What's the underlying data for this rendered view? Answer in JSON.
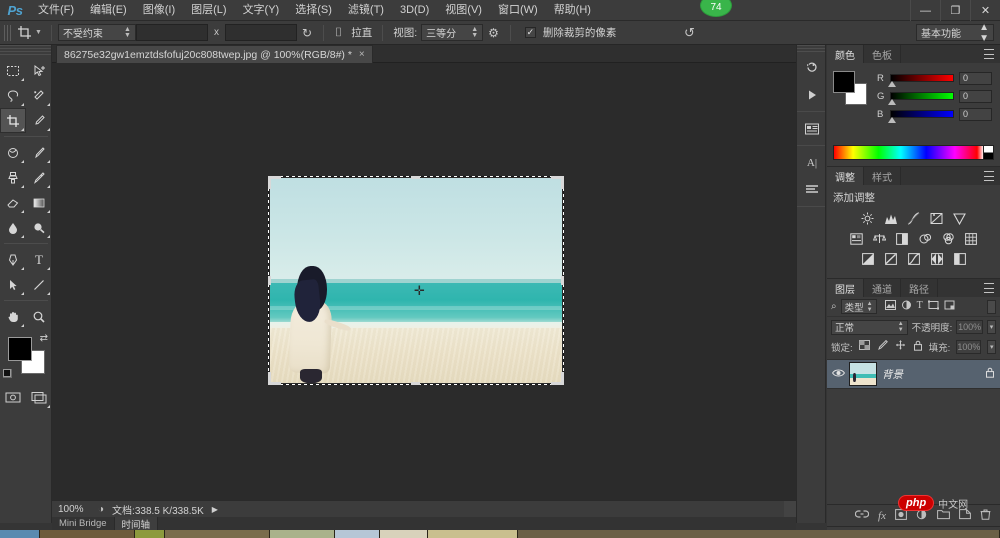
{
  "app": {
    "logo": "Ps",
    "badge_count": "74",
    "badge_color": "#39b54a"
  },
  "menubar": {
    "items": [
      {
        "label": "文件(F)",
        "name": "menu-file"
      },
      {
        "label": "编辑(E)",
        "name": "menu-edit"
      },
      {
        "label": "图像(I)",
        "name": "menu-image"
      },
      {
        "label": "图层(L)",
        "name": "menu-layer"
      },
      {
        "label": "文字(Y)",
        "name": "menu-type"
      },
      {
        "label": "选择(S)",
        "name": "menu-select"
      },
      {
        "label": "滤镜(T)",
        "name": "menu-filter"
      },
      {
        "label": "3D(D)",
        "name": "menu-3d"
      },
      {
        "label": "视图(V)",
        "name": "menu-view"
      },
      {
        "label": "窗口(W)",
        "name": "menu-window"
      },
      {
        "label": "帮助(H)",
        "name": "menu-help"
      }
    ],
    "window_controls": {
      "minimize": "—",
      "restore": "❐",
      "close": "✕"
    }
  },
  "options_bar": {
    "tool_icon": "crop-icon",
    "ratio_select": "不受约束",
    "width_value": "",
    "height_value": "",
    "separator_x": "x",
    "swap_icon": "↻",
    "clear_icon": "⌷",
    "straighten_label": "拉直",
    "view_label": "视图:",
    "view_select": "三等分",
    "settings_icon": "gear-icon",
    "delete_cropped_label": "删除裁剪的像素",
    "delete_cropped_checked": "✓",
    "reset_icon": "↺",
    "workspace_select": "基本功能"
  },
  "document": {
    "tab_title": "86275e32gw1emztdsfofuj20c808twep.jpg @ 100%(RGB/8#) *",
    "close_icon": "×"
  },
  "toolbar": {
    "tools": [
      {
        "name": "marquee-tool",
        "glyph": "▢",
        "active": false
      },
      {
        "name": "move-tool",
        "glyph": "⊹",
        "active": false
      },
      {
        "name": "lasso-tool",
        "glyph": "◌",
        "active": false
      },
      {
        "name": "quick-selection-tool",
        "glyph": "✦",
        "active": false
      },
      {
        "name": "crop-tool",
        "glyph": "⌗",
        "active": true
      },
      {
        "name": "eyedropper-tool",
        "glyph": "✎",
        "active": false
      },
      {
        "name": "spot-healing-tool",
        "glyph": "◉",
        "active": false
      },
      {
        "name": "brush-tool",
        "glyph": "✏",
        "active": false
      },
      {
        "name": "clone-stamp-tool",
        "glyph": "⌷",
        "active": false
      },
      {
        "name": "history-brush-tool",
        "glyph": "✒",
        "active": false
      },
      {
        "name": "eraser-tool",
        "glyph": "◐",
        "active": false
      },
      {
        "name": "gradient-tool",
        "glyph": "▤",
        "active": false
      },
      {
        "name": "blur-tool",
        "glyph": "💧",
        "active": false
      },
      {
        "name": "dodge-tool",
        "glyph": "⚲",
        "active": false
      },
      {
        "name": "pen-tool",
        "glyph": "✐",
        "active": false
      },
      {
        "name": "type-tool",
        "glyph": "T",
        "active": false
      },
      {
        "name": "path-selection-tool",
        "glyph": "➤",
        "active": false
      },
      {
        "name": "line-shape-tool",
        "glyph": "／",
        "active": false
      },
      {
        "name": "hand-tool",
        "glyph": "✋",
        "active": false
      },
      {
        "name": "zoom-tool",
        "glyph": "🔍",
        "active": false
      }
    ],
    "foreground_color": "#000000",
    "background_color": "#ffffff",
    "swap_icon": "⇄",
    "quickmask_icon": "◱",
    "screenmode_icon": "❐"
  },
  "canvas": {
    "background_color": "#2b2b2b",
    "cursor_glyph": "✛",
    "image_alt": "beach-photo"
  },
  "statusbar": {
    "zoom": "100%",
    "zoom_icon": "◑",
    "doc_info": "文档:338.5 K/338.5K",
    "expand_icon": "▶"
  },
  "bottom_tabs": [
    {
      "label": "Mini Bridge",
      "name": "tab-mini-bridge",
      "active": false
    },
    {
      "label": "时间轴",
      "name": "tab-timeline",
      "active": true
    }
  ],
  "minidock": {
    "buttons": [
      {
        "name": "history-panel-icon",
        "glyph": "↻"
      },
      {
        "name": "actions-panel-icon",
        "glyph": "▶"
      },
      {
        "name": "mini-bridge-icon",
        "glyph": "▣"
      },
      {
        "name": "character-panel-icon",
        "glyph": "A|"
      },
      {
        "name": "paragraph-panel-icon",
        "glyph": "◀"
      }
    ]
  },
  "color_panel": {
    "tabs": [
      {
        "label": "颜色",
        "name": "tab-color",
        "active": true
      },
      {
        "label": "色板",
        "name": "tab-swatches",
        "active": false
      }
    ],
    "channels": [
      {
        "label": "R",
        "value": "0"
      },
      {
        "label": "G",
        "value": "0"
      },
      {
        "label": "B",
        "value": "0"
      }
    ],
    "foreground_color": "#000000",
    "background_color": "#ffffff"
  },
  "adjustments_panel": {
    "tabs": [
      {
        "label": "调整",
        "name": "tab-adjustments",
        "active": true
      },
      {
        "label": "样式",
        "name": "tab-styles",
        "active": false
      }
    ],
    "title": "添加调整",
    "row1": [
      {
        "name": "brightness-contrast-icon",
        "glyph": "☀"
      },
      {
        "name": "levels-icon",
        "glyph": "▄"
      },
      {
        "name": "curves-icon",
        "glyph": "∿"
      },
      {
        "name": "exposure-icon",
        "glyph": "⊿"
      },
      {
        "name": "vibrance-icon",
        "glyph": "▽"
      }
    ],
    "row2": [
      {
        "name": "hue-saturation-icon",
        "glyph": "▩"
      },
      {
        "name": "color-balance-icon",
        "glyph": "⚖"
      },
      {
        "name": "black-white-icon",
        "glyph": "◨"
      },
      {
        "name": "photo-filter-icon",
        "glyph": "◍"
      },
      {
        "name": "channel-mixer-icon",
        "glyph": "❂"
      },
      {
        "name": "color-lookup-icon",
        "glyph": "▦"
      }
    ],
    "row3": [
      {
        "name": "invert-icon",
        "glyph": "◪"
      },
      {
        "name": "posterize-icon",
        "glyph": "◲"
      },
      {
        "name": "threshold-icon",
        "glyph": "◩"
      },
      {
        "name": "gradient-map-icon",
        "glyph": "◤"
      },
      {
        "name": "selective-color-icon",
        "glyph": "◧"
      }
    ]
  },
  "layers_panel": {
    "tabs": [
      {
        "label": "图层",
        "name": "tab-layers",
        "active": true
      },
      {
        "label": "通道",
        "name": "tab-channels",
        "active": false
      },
      {
        "label": "路径",
        "name": "tab-paths",
        "active": false
      }
    ],
    "filter": {
      "search_icon": "⌕",
      "kind_label": "类型",
      "icons": [
        {
          "name": "filter-pixel-icon",
          "glyph": "▣"
        },
        {
          "name": "filter-adjustment-icon",
          "glyph": "◑"
        },
        {
          "name": "filter-type-icon",
          "glyph": "T"
        },
        {
          "name": "filter-shape-icon",
          "glyph": "▭"
        },
        {
          "name": "filter-smart-icon",
          "glyph": "⌸"
        }
      ]
    },
    "blend_mode": "正常",
    "opacity_label": "不透明度:",
    "opacity_value": "100%",
    "lock_label": "锁定:",
    "lock_icons": [
      {
        "name": "lock-transparency-icon",
        "glyph": "▨"
      },
      {
        "name": "lock-image-icon",
        "glyph": "✎"
      },
      {
        "name": "lock-position-icon",
        "glyph": "✥"
      },
      {
        "name": "lock-all-icon",
        "glyph": "🔒"
      }
    ],
    "fill_label": "填充:",
    "fill_value": "100%",
    "layers": [
      {
        "name": "背景",
        "visible_icon": "◉",
        "lock_icon": "🔒",
        "selected": true
      }
    ],
    "bottom_buttons": [
      {
        "name": "link-layers-icon",
        "glyph": "🔗"
      },
      {
        "name": "layer-style-icon",
        "glyph": "fx"
      },
      {
        "name": "layer-mask-icon",
        "glyph": "▣"
      },
      {
        "name": "new-fill-adjustment-icon",
        "glyph": "◑"
      },
      {
        "name": "new-group-icon",
        "glyph": "🗀"
      },
      {
        "name": "new-layer-icon",
        "glyph": "❏"
      },
      {
        "name": "delete-layer-icon",
        "glyph": "🗑"
      }
    ]
  },
  "watermark": {
    "brand": "php",
    "site": "中文网"
  }
}
